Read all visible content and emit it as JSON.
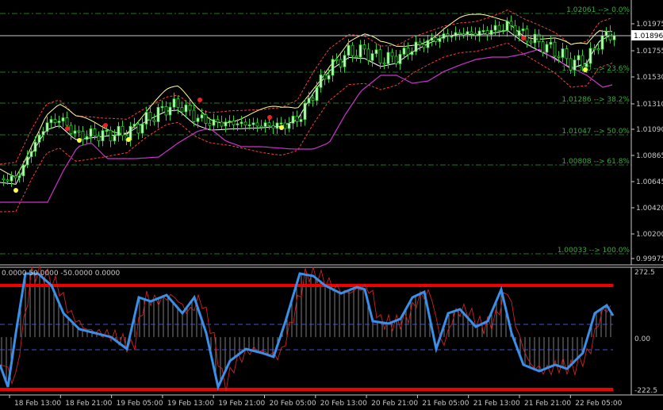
{
  "price_pane": {
    "current_price": "1.01896",
    "axis_labels": [
      "1.01975",
      "1.01755",
      "1.01530",
      "1.01310",
      "1.01090",
      "1.00865",
      "1.00645",
      "1.00420",
      "1.00200",
      "0.99975"
    ],
    "fib_levels": [
      {
        "label": "1.02061 --> 0.0%"
      },
      {
        "label": "1.01530 --> 23.6%"
      },
      {
        "label": "1.01286 --> 38.2%"
      },
      {
        "label": "1.01047 --> 50.0%"
      },
      {
        "label": "1.00808 --> 61.8%"
      },
      {
        "label": "1.00033 --> 100.0%"
      }
    ]
  },
  "oscillator_pane": {
    "header": "0.0000 50.0000 -50.0000 0.0000",
    "axis_labels": [
      "272.5",
      "0.00",
      "-222.5"
    ]
  },
  "time_axis": [
    "18 Feb 13:00",
    "18 Feb 21:00",
    "19 Feb 05:00",
    "19 Feb 13:00",
    "19 Feb 21:00",
    "20 Feb 05:00",
    "20 Feb 13:00",
    "20 Feb 21:00",
    "21 Feb 05:00",
    "21 Feb 13:00",
    "21 Feb 21:00",
    "22 Feb 05:00"
  ],
  "colors": {
    "background": "#000000",
    "bull_candle": "#c8ffc8",
    "bear_candle": "#000000",
    "candle_wick": "#33cc33",
    "fib_line": "#1f7a1f",
    "bands": "#ff3b3b",
    "middle_line": "#ffffff",
    "lower_line": "#cc33cc",
    "yellow_band": "#ffff99",
    "cci_main": "#3a8fe8",
    "cci_signal": "#cc2222",
    "level_line": "#ee0000",
    "dashed_level": "#4455cc",
    "text": "#c8c8c8"
  }
}
